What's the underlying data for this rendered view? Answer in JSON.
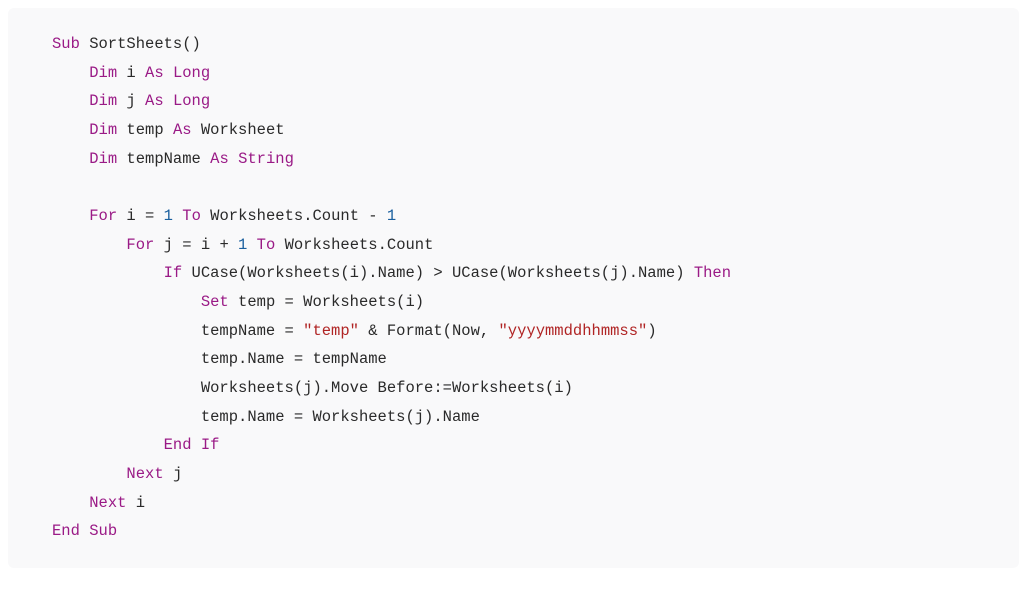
{
  "code": {
    "lines": [
      [
        {
          "t": "keyword",
          "v": "Sub"
        },
        {
          "t": "plain",
          "v": " SortSheets()"
        }
      ],
      [
        {
          "t": "plain",
          "v": "    "
        },
        {
          "t": "keyword",
          "v": "Dim"
        },
        {
          "t": "plain",
          "v": " i "
        },
        {
          "t": "keyword",
          "v": "As"
        },
        {
          "t": "plain",
          "v": " "
        },
        {
          "t": "type",
          "v": "Long"
        }
      ],
      [
        {
          "t": "plain",
          "v": "    "
        },
        {
          "t": "keyword",
          "v": "Dim"
        },
        {
          "t": "plain",
          "v": " j "
        },
        {
          "t": "keyword",
          "v": "As"
        },
        {
          "t": "plain",
          "v": " "
        },
        {
          "t": "type",
          "v": "Long"
        }
      ],
      [
        {
          "t": "plain",
          "v": "    "
        },
        {
          "t": "keyword",
          "v": "Dim"
        },
        {
          "t": "plain",
          "v": " temp "
        },
        {
          "t": "keyword",
          "v": "As"
        },
        {
          "t": "plain",
          "v": " Worksheet"
        }
      ],
      [
        {
          "t": "plain",
          "v": "    "
        },
        {
          "t": "keyword",
          "v": "Dim"
        },
        {
          "t": "plain",
          "v": " tempName "
        },
        {
          "t": "keyword",
          "v": "As"
        },
        {
          "t": "plain",
          "v": " "
        },
        {
          "t": "type",
          "v": "String"
        }
      ],
      [],
      [
        {
          "t": "plain",
          "v": "    "
        },
        {
          "t": "keyword",
          "v": "For"
        },
        {
          "t": "plain",
          "v": " i = "
        },
        {
          "t": "number",
          "v": "1"
        },
        {
          "t": "plain",
          "v": " "
        },
        {
          "t": "keyword",
          "v": "To"
        },
        {
          "t": "plain",
          "v": " Worksheets.Count - "
        },
        {
          "t": "number",
          "v": "1"
        }
      ],
      [
        {
          "t": "plain",
          "v": "        "
        },
        {
          "t": "keyword",
          "v": "For"
        },
        {
          "t": "plain",
          "v": " j = i + "
        },
        {
          "t": "number",
          "v": "1"
        },
        {
          "t": "plain",
          "v": " "
        },
        {
          "t": "keyword",
          "v": "To"
        },
        {
          "t": "plain",
          "v": " Worksheets.Count"
        }
      ],
      [
        {
          "t": "plain",
          "v": "            "
        },
        {
          "t": "keyword",
          "v": "If"
        },
        {
          "t": "plain",
          "v": " UCase(Worksheets(i).Name) > UCase(Worksheets(j).Name) "
        },
        {
          "t": "keyword",
          "v": "Then"
        }
      ],
      [
        {
          "t": "plain",
          "v": "                "
        },
        {
          "t": "keyword",
          "v": "Set"
        },
        {
          "t": "plain",
          "v": " temp = Worksheets(i)"
        }
      ],
      [
        {
          "t": "plain",
          "v": "                tempName = "
        },
        {
          "t": "string",
          "v": "\"temp\""
        },
        {
          "t": "plain",
          "v": " & Format(Now, "
        },
        {
          "t": "string",
          "v": "\"yyyymmddhhmmss\""
        },
        {
          "t": "plain",
          "v": ")"
        }
      ],
      [
        {
          "t": "plain",
          "v": "                temp.Name = tempName"
        }
      ],
      [
        {
          "t": "plain",
          "v": "                Worksheets(j).Move Before:=Worksheets(i)"
        }
      ],
      [
        {
          "t": "plain",
          "v": "                temp.Name = Worksheets(j).Name"
        }
      ],
      [
        {
          "t": "plain",
          "v": "            "
        },
        {
          "t": "keyword",
          "v": "End"
        },
        {
          "t": "plain",
          "v": " "
        },
        {
          "t": "keyword",
          "v": "If"
        }
      ],
      [
        {
          "t": "plain",
          "v": "        "
        },
        {
          "t": "keyword",
          "v": "Next"
        },
        {
          "t": "plain",
          "v": " j"
        }
      ],
      [
        {
          "t": "plain",
          "v": "    "
        },
        {
          "t": "keyword",
          "v": "Next"
        },
        {
          "t": "plain",
          "v": " i"
        }
      ],
      [
        {
          "t": "keyword",
          "v": "End"
        },
        {
          "t": "plain",
          "v": " "
        },
        {
          "t": "keyword",
          "v": "Sub"
        }
      ]
    ]
  }
}
